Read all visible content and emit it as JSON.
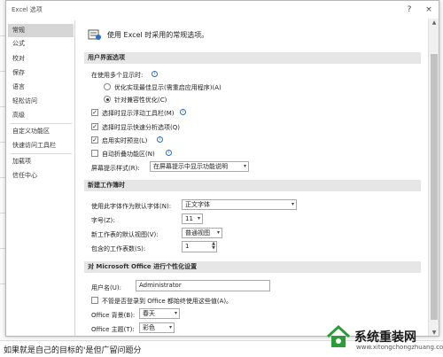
{
  "background": {
    "bottom_text": "如果就是自己的目标的'是但广留问题分"
  },
  "dialog": {
    "title": "Excel 选项",
    "help_label": "?",
    "close_label": "×"
  },
  "sidebar": {
    "items": [
      {
        "label": "常规",
        "active": true
      },
      {
        "label": "公式"
      },
      {
        "label": "校对"
      },
      {
        "label": "保存"
      },
      {
        "label": "语言"
      },
      {
        "label": "轻松访问"
      },
      {
        "label": "高级"
      },
      {
        "label": "自定义功能区"
      },
      {
        "label": "快速访问工具栏"
      },
      {
        "label": "加载项"
      },
      {
        "label": "信任中心"
      }
    ]
  },
  "content": {
    "header": "使用 Excel 时采用的常规选项。",
    "ui_section": {
      "title": "用户界面选项",
      "multi_display_label": "在使用多个显示时:",
      "radio_optimize": "优化实现最佳显示(需重启应用程序)(A)",
      "radio_compat": "针对兼容性优化(C)",
      "chk_mini_toolbar": "选择时显示浮动工具栏(M)",
      "chk_quick_analysis": "选择时显示快速分析选项(Q)",
      "chk_live_preview": "启用实时预览(L)",
      "chk_collapse_ribbon": "自动折叠功能区(N)",
      "screentip_label": "屏幕提示样式(R):",
      "screentip_value": "在屏幕提示中显示功能说明"
    },
    "new_wb_section": {
      "title": "新建工作簿时",
      "font_label": "使用此字体作为默认字体(N):",
      "font_value": "正文字体",
      "size_label": "字号(Z):",
      "size_value": "11",
      "view_label": "新工作表的默认视图(V):",
      "view_value": "普通视图",
      "sheets_label": "包含的工作表数(S):",
      "sheets_value": "1"
    },
    "personal_section": {
      "title": "对 Microsoft Office 进行个性化设置",
      "username_label": "用户名(U):",
      "username_value": "Administrator",
      "always_use_label": "不管是否登录到 Office 都始终使用这些值(A)。",
      "bg_label": "Office 背景(B):",
      "bg_value": "春天",
      "theme_label": "Office 主题(T):",
      "theme_value": "彩色"
    }
  },
  "watermark": {
    "text": "系统重装网",
    "sub": "www.xitongchongzhuang.com"
  }
}
